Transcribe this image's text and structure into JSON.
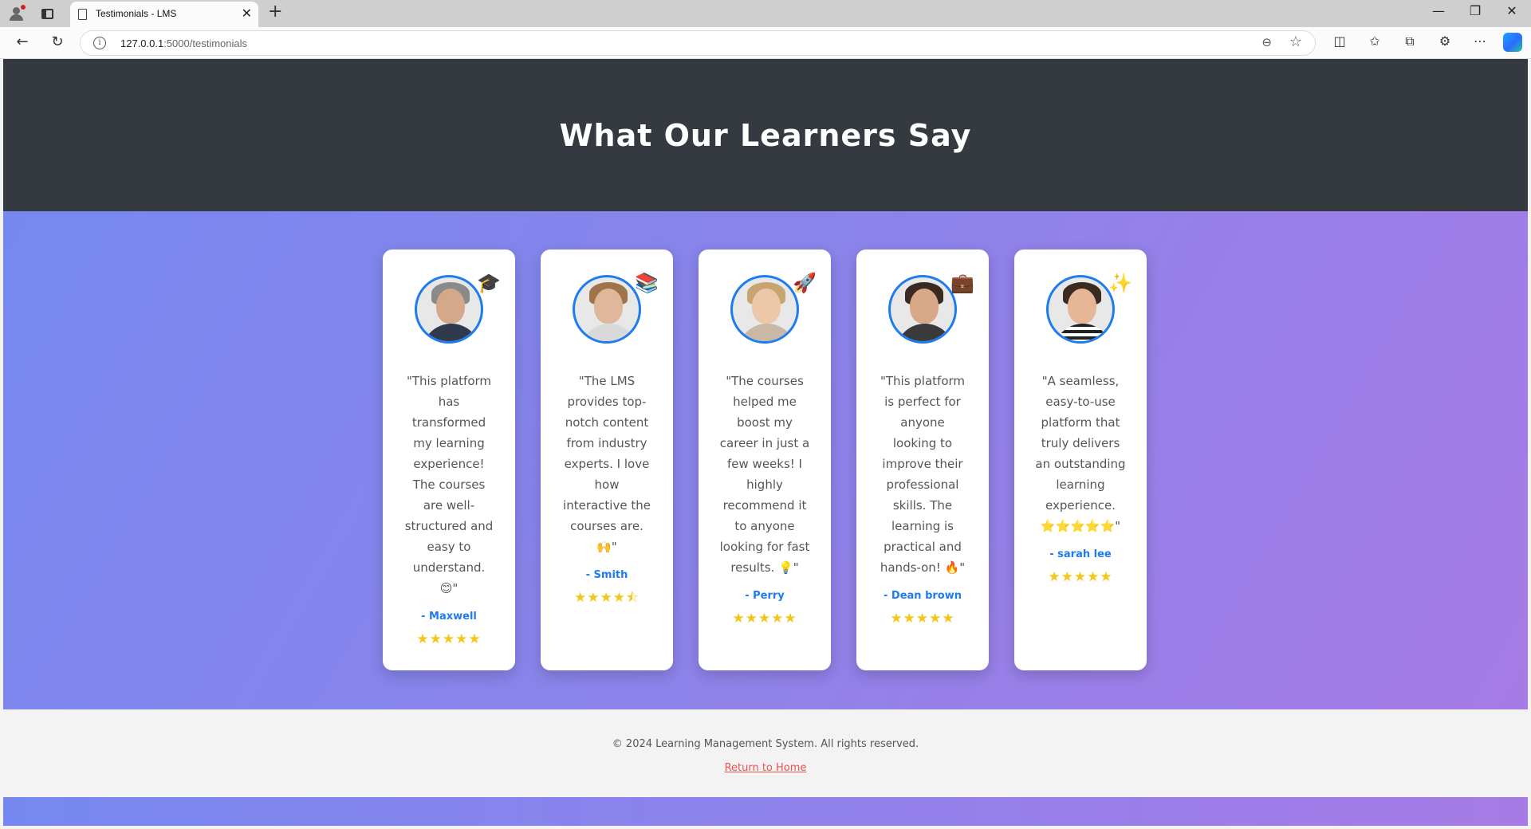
{
  "browser": {
    "tab_title": "Testimonials - LMS",
    "url_host": "127.0.0.1",
    "url_path": ":5000/testimonials"
  },
  "page": {
    "heading": "What Our Learners Say"
  },
  "testimonials": [
    {
      "quote": "\"This platform has transformed my learning experience! The courses are well-structured and easy to understand. 😊\"",
      "author": "- Maxwell",
      "stars": "★★★★★",
      "badge": "🎓",
      "badge_icon": "graduation-cap-icon",
      "rating": 5
    },
    {
      "quote": "\"The LMS provides top-notch content from industry experts. I love how interactive the courses are. 🙌\"",
      "author": "- Smith",
      "stars": "★★★★⯪",
      "badge": "📚",
      "badge_icon": "books-icon",
      "rating": 4.5
    },
    {
      "quote": "\"The courses helped me boost my career in just a few weeks! I highly recommend it to anyone looking for fast results. 💡\"",
      "author": "- Perry",
      "stars": "★★★★★",
      "badge": "🚀",
      "badge_icon": "rocket-icon",
      "rating": 5
    },
    {
      "quote": "\"This platform is perfect for anyone looking to improve their professional skills. The learning is practical and hands-on! 🔥\"",
      "author": "- Dean brown",
      "stars": "★★★★★",
      "badge": "💼",
      "badge_icon": "briefcase-icon",
      "rating": 5
    },
    {
      "quote": "\"A seamless, easy-to-use platform that truly delivers an outstanding learning experience. ⭐⭐⭐⭐⭐\"",
      "author": "- sarah lee",
      "stars": "★★★★★",
      "badge": "✨",
      "badge_icon": "sparkles-icon",
      "rating": 5
    }
  ],
  "footer": {
    "copyright": "© 2024 Learning Management System. All rights reserved.",
    "home_link": "Return to Home"
  },
  "colors": {
    "hero_bg": "#343a40",
    "accent_blue": "#1e7cf0",
    "star_gold": "#f5c518",
    "link_red": "#e8554e"
  }
}
